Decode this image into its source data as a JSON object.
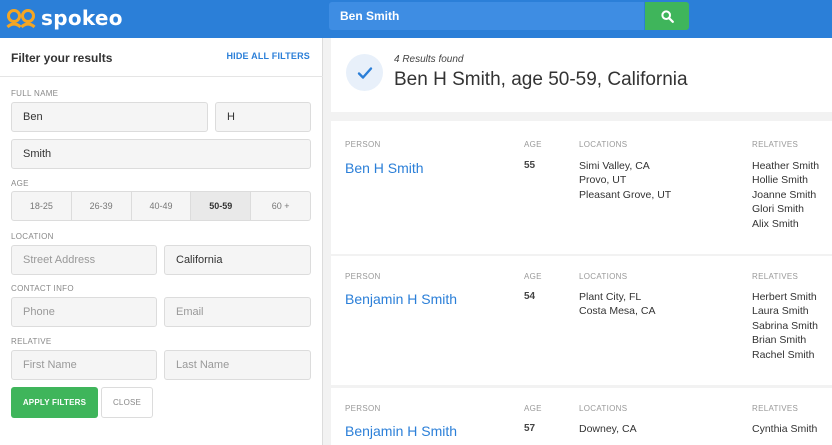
{
  "header": {
    "brand": "spokeo",
    "search_value": "Ben Smith"
  },
  "sidebar": {
    "title": "Filter your results",
    "hide_all": "HIDE ALL FILTERS",
    "full_name_label": "FULL NAME",
    "first_name": "Ben",
    "middle_initial": "H",
    "last_name": "Smith",
    "age_label": "AGE",
    "age_options": [
      "18-25",
      "26-39",
      "40-49",
      "50-59",
      "60 +"
    ],
    "age_selected": "50-59",
    "location_label": "LOCATION",
    "street_placeholder": "Street Address",
    "state_value": "California",
    "contact_label": "CONTACT INFO",
    "phone_placeholder": "Phone",
    "email_placeholder": "Email",
    "relative_label": "RELATIVE",
    "relative_first_placeholder": "First Name",
    "relative_last_placeholder": "Last Name",
    "apply_label": "APPLY FILTERS",
    "close_label": "CLOSE"
  },
  "summary": {
    "count_text": "4 Results found",
    "title": "Ben H Smith, age 50-59, California"
  },
  "columns": {
    "person": "PERSON",
    "age": "AGE",
    "locations": "LOCATIONS",
    "relatives": "RELATIVES"
  },
  "results": [
    {
      "name": "Ben H Smith",
      "age": "55",
      "locations": [
        "Simi Valley, CA",
        "Provo, UT",
        "Pleasant Grove, UT"
      ],
      "relatives": [
        "Heather Smith",
        "Hollie Smith",
        "Joanne Smith",
        "Glori Smith",
        "Alix Smith"
      ]
    },
    {
      "name": "Benjamin H Smith",
      "age": "54",
      "locations": [
        "Plant City, FL",
        "Costa Mesa, CA"
      ],
      "relatives": [
        "Herbert Smith",
        "Laura Smith",
        "Sabrina Smith",
        "Brian Smith",
        "Rachel Smith"
      ]
    },
    {
      "name": "Benjamin H Smith",
      "age": "57",
      "locations": [
        "Downey, CA"
      ],
      "relatives": [
        "Cynthia Smith"
      ]
    }
  ],
  "colors": {
    "brand_blue": "#2b7fd8",
    "action_green": "#3fb55b"
  },
  "icons": {
    "logo": "spokeo-logo-icon",
    "search": "search-icon",
    "check": "check-icon"
  }
}
